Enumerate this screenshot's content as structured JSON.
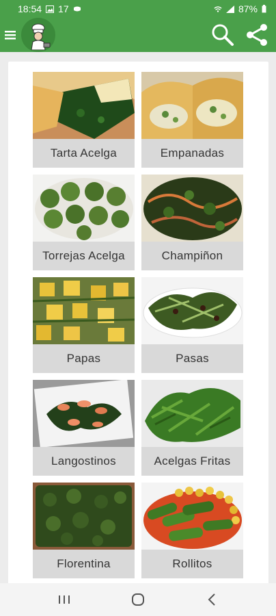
{
  "status_bar": {
    "time": "18:54",
    "notif_count": "17",
    "battery": "87%"
  },
  "app_bar": {
    "menu_icon": "hamburger-menu-icon",
    "logo": "chef-logo",
    "search_icon": "search-icon",
    "share_icon": "share-icon"
  },
  "recipes": [
    {
      "label": "Tarta Acelga"
    },
    {
      "label": "Empanadas"
    },
    {
      "label": "Torrejas Acelga"
    },
    {
      "label": "Champiñon"
    },
    {
      "label": "Papas"
    },
    {
      "label": "Pasas"
    },
    {
      "label": "Langostinos"
    },
    {
      "label": "Acelgas Fritas"
    },
    {
      "label": "Florentina"
    },
    {
      "label": "Rollitos"
    }
  ],
  "nav": {
    "recents_icon": "recents-icon",
    "home_icon": "home-icon",
    "back_icon": "back-icon"
  },
  "colors": {
    "primary": "#4aa04a",
    "tile_bg": "#d9d9d9",
    "background": "#ececec"
  }
}
